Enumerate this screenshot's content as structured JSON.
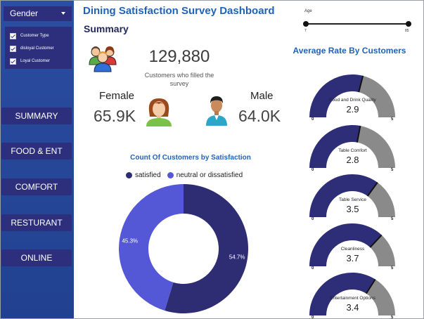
{
  "sidebar": {
    "gender_select": "Gender",
    "checkboxes": [
      {
        "label": "Customer Type"
      },
      {
        "label": "disloyal Customer"
      },
      {
        "label": "Loyal Customer"
      }
    ],
    "nav": [
      {
        "label": "SUMMARY"
      },
      {
        "label": "FOOD & ENT"
      },
      {
        "label": "COMFORT"
      },
      {
        "label": "RESTURANT"
      },
      {
        "label": "ONLINE"
      }
    ]
  },
  "header": {
    "title": "Dining Satisfaction Survey Dashboard",
    "section": "Summary"
  },
  "age_slicer": {
    "label": "Age",
    "min_label": "7",
    "max_label": "85"
  },
  "kpis": {
    "total_value": "129,880",
    "total_caption": "Customers who filled the survey",
    "female_label": "Female",
    "female_value": "65.9K",
    "male_label": "Male",
    "male_value": "64.0K"
  },
  "colors": {
    "satisfied": "#2e2d73",
    "neutral": "#5558d6",
    "gauge_fill": "#2d2d78",
    "gauge_rest": "#8a8a8a"
  },
  "icons": {
    "group": "group-people-icon",
    "female": "female-avatar-icon",
    "male": "male-avatar-icon"
  },
  "chart_data": [
    {
      "type": "pie",
      "title": "Count Of Customers by Satisfaction",
      "legend": "top",
      "categories": [
        "satisfied",
        "neutral or dissatisfied"
      ],
      "values": [
        54.7,
        45.3
      ],
      "data_labels": [
        "54.7%",
        "45.3%"
      ]
    },
    {
      "type": "gauge",
      "title": "Average Rate By Customers",
      "range": [
        0,
        5
      ],
      "min_label": "0",
      "max_label": "5",
      "gauges": [
        {
          "name": "Food and Drink Quality",
          "value": 2.9,
          "value_label": "2.9"
        },
        {
          "name": "Table Comfort",
          "value": 2.8,
          "value_label": "2.8"
        },
        {
          "name": "Table Service",
          "value": 3.5,
          "value_label": "3.5"
        },
        {
          "name": "Cleanliness",
          "value": 3.7,
          "value_label": "3.7"
        },
        {
          "name": "Entertainment Options",
          "value": 3.4,
          "value_label": "3.4"
        }
      ]
    }
  ]
}
